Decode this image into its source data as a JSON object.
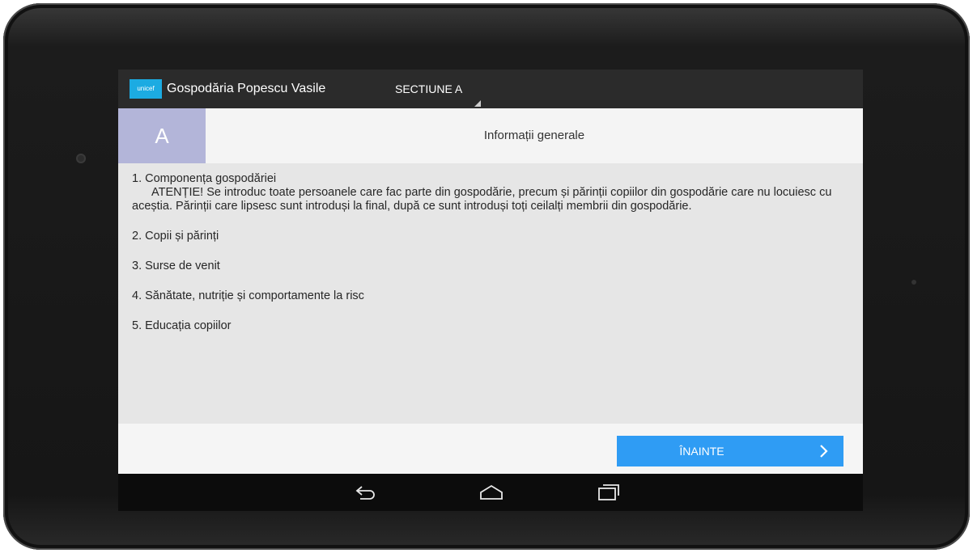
{
  "app": {
    "logo_text": "unicef",
    "title": "Gospodăria Popescu Vasile",
    "section_selector": "SECTIUNE A"
  },
  "section": {
    "letter": "A",
    "title": "Informații generale"
  },
  "items": [
    {
      "text": "1. Componența gospodăriei",
      "note": "ATENȚIE! Se introduc toate persoanele care fac parte din gospodărie, precum și părinții copiilor din gospodărie care nu locuiesc cu aceștia. Părinții care lipsesc sunt introduși la final, după ce sunt introduși toți ceilalți membrii din gospodărie."
    },
    {
      "text": "2. Copii și părinți"
    },
    {
      "text": "3. Surse de venit"
    },
    {
      "text": "4. Sănătate, nutriție și comportamente la risc"
    },
    {
      "text": "5. Educația copiilor"
    }
  ],
  "footer": {
    "next_label": "ÎNAINTE"
  },
  "navbar": {
    "icons": [
      "back-icon",
      "home-icon",
      "recents-icon"
    ]
  },
  "colors": {
    "action_bar": "#2b2b2b",
    "section_badge": "#b3b5d9",
    "next_button": "#2f9cf4",
    "unicef_blue": "#1cabe2"
  }
}
